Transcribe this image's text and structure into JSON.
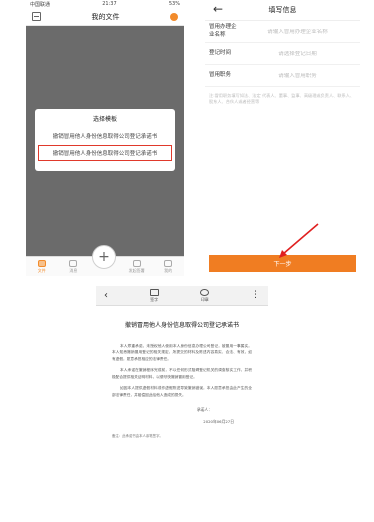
{
  "left_phone": {
    "status": {
      "carrier": "中国联通",
      "time": "21:37",
      "battery": "53%"
    },
    "header": {
      "title": "我的文件"
    },
    "dialog": {
      "title": "选择模板",
      "option1": "撤销冒用他人身份信息取得公司登记承诺书",
      "option2": "撤销冒用他人身份信息取得公司登记承诺书"
    },
    "tabbar": [
      {
        "label": "文件"
      },
      {
        "label": "消息"
      },
      {
        "label": "发起签署"
      },
      {
        "label": "我的"
      }
    ]
  },
  "right_phone": {
    "header": {
      "title": "填写信息"
    },
    "fields": [
      {
        "label": "冒用办理企业名称",
        "placeholder": "请输入冒用办理企业名称"
      },
      {
        "label": "登记时间",
        "placeholder": "请选择登记日期"
      },
      {
        "label": "冒用职务",
        "placeholder": "请输入冒用职务"
      }
    ],
    "note": "注:冒用职务填写如法、法定 代表人、董事、监事、高级理或负责人、联系人、股东人、合伙人或者经营等",
    "next_button": "下一步"
  },
  "doc_view": {
    "toolbar": {
      "sign": "签字",
      "stamp": "印章"
    },
    "title": "撤销冒用他人身份信息取得公司登记承诺书",
    "paragraphs": [
      "本人郑重承诺，未授权他人使用本人身份信息办理公司登记，被冒用一事属实。本人知悉撤销冒用登记的相关规定，所提交的材料及陈述内容真实、合法、有效，如有虚假，愿意承担相应的法律责任。",
      "本人承诺在撤销程序完成前，不以任何形式阻碍登记机关的调查核实工作，并积极配合提供相关证明材料，以便尽快撤销冒用登记。",
      "如因本人提供虚假材料或作虚假陈述导致撤销错误，本人愿意承担由此产生的全部法律责任，并赔偿因此给他人造成的损失。"
    ],
    "signer": "承诺人：",
    "date": "2020年06月27日",
    "note": "备注：此承诺书由本人亲笔签字。"
  }
}
